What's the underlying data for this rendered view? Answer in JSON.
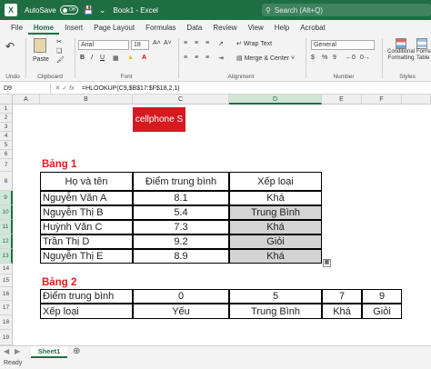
{
  "titlebar": {
    "logo": "X",
    "autosave_label": "AutoSave",
    "autosave_state": "Off",
    "doc_title": "Book1 - Excel",
    "search_placeholder": "Search (Alt+Q)"
  },
  "tabs": [
    "File",
    "Home",
    "Insert",
    "Page Layout",
    "Formulas",
    "Data",
    "Review",
    "View",
    "Help",
    "Acrobat"
  ],
  "ribbon": {
    "undo_label": "Undo",
    "paste_label": "Paste",
    "clipboard_label": "Clipboard",
    "font_name": "Arial",
    "font_size": "18",
    "font_label": "Font",
    "bold": "B",
    "italic": "I",
    "underline": "U",
    "wrap_text": "Wrap Text",
    "merge_center": "Merge & Center",
    "alignment_label": "Alignment",
    "number_format": "General",
    "number_label": "Number",
    "cond_format": "Conditional Formatting",
    "format_table": "Format as Table",
    "styles_label": "Styles"
  },
  "formula_bar": {
    "name_box": "D9",
    "formula": "=HLOOKUP(C9,$B$17:$F$18,2,1)"
  },
  "columns": [
    "A",
    "B",
    "C",
    "D",
    "E",
    "F"
  ],
  "rows": [
    "1",
    "2",
    "3",
    "4",
    "5",
    "6",
    "7",
    "8",
    "9",
    "10",
    "11",
    "12",
    "13",
    "14",
    "15",
    "16",
    "17",
    "18",
    "19"
  ],
  "logo_text": "cellphone S",
  "table1": {
    "caption": "Bảng 1",
    "headers": [
      "Họ và tên",
      "Điểm trung bình",
      "Xếp loại"
    ],
    "rows": [
      [
        "Nguyễn Văn A",
        "8.1",
        "Khá"
      ],
      [
        "Nguyễn Thị B",
        "5.4",
        "Trung Bình"
      ],
      [
        "Huỳnh Văn C",
        "7.3",
        "Khá"
      ],
      [
        "Trần Thị D",
        "9.2",
        "Giỏi"
      ],
      [
        "Nguyễn Thị E",
        "8.9",
        "Khá"
      ]
    ]
  },
  "table2": {
    "caption": "Bảng 2",
    "row1": [
      "Điểm trung bình",
      "0",
      "5",
      "7",
      "9"
    ],
    "row2": [
      "Xếp loại",
      "Yếu",
      "Trung Bình",
      "Khá",
      "Giỏi"
    ]
  },
  "sheet_tab": "Sheet1",
  "status": "Ready",
  "colors": {
    "excel_green": "#1f6e43",
    "selected_gray": "#d4d4d4",
    "caption_red": "#e81c1c"
  }
}
